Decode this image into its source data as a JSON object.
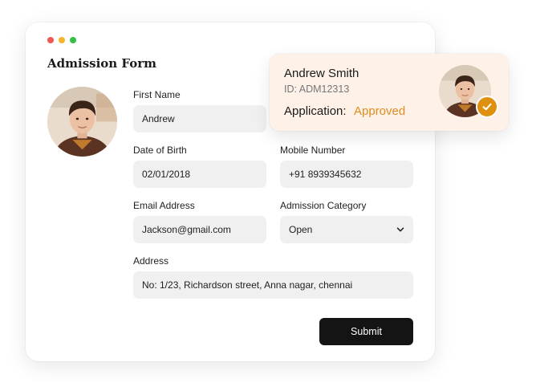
{
  "form": {
    "title": "Admission Form",
    "fields": {
      "first_name": {
        "label": "First Name",
        "value": "Andrew"
      },
      "dob": {
        "label": "Date of Birth",
        "value": "02/01/2018"
      },
      "mobile": {
        "label": "Mobile Number",
        "value": "+91 8939345632"
      },
      "email": {
        "label": "Email Address",
        "value": "Jackson@gmail.com"
      },
      "category": {
        "label": "Admission Category",
        "value": "Open"
      },
      "address": {
        "label": "Address",
        "value": "No: 1/23, Richardson street, Anna nagar, chennai"
      }
    },
    "submit_label": "Submit"
  },
  "card": {
    "name": "Andrew Smith",
    "id": "ID: ADM12313",
    "application_label": "Application:",
    "status": "Approved"
  },
  "icons": {
    "chevron": "chevron-down-icon",
    "check": "check-icon"
  },
  "colors": {
    "accent": "#e0900f",
    "status_text": "#e08d1f",
    "card_bg": "#fdf1e8",
    "button_bg": "#141414",
    "field_bg": "#f0f0f0"
  }
}
